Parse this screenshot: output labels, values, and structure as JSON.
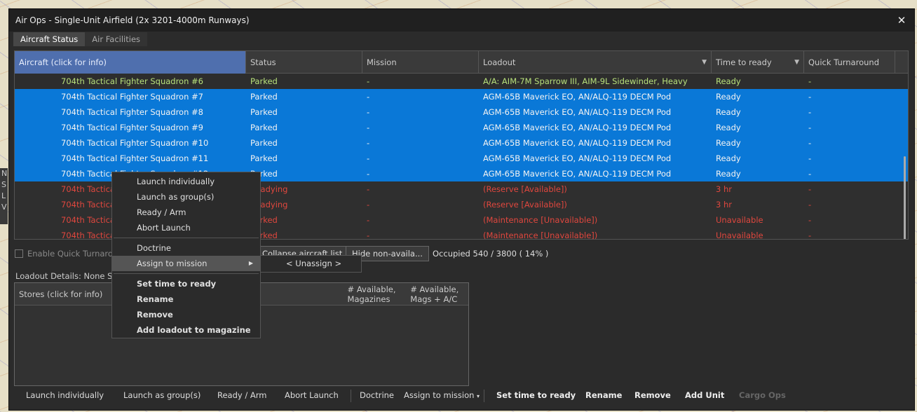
{
  "window": {
    "title": "Air Ops - Single-Unit Airfield (2x 3201-4000m Runways)",
    "close": "✕"
  },
  "tabs": [
    {
      "label": "Aircraft Status"
    },
    {
      "label": "Air Facilities"
    }
  ],
  "grid": {
    "headers": [
      "Aircraft (click for info)",
      "Status",
      "Mission",
      "Loadout",
      "Time to ready",
      "Quick Turnaround"
    ],
    "rows": [
      {
        "aircraft": "704th Tactical Fighter Squadron #6",
        "status": "Parked",
        "mission": "-",
        "loadout": "A/A: AIM-7M Sparrow III, AIM-9L Sidewinder, Heavy",
        "time": "Ready",
        "quick": "-"
      },
      {
        "aircraft": "704th Tactical Fighter Squadron #7",
        "status": "Parked",
        "mission": "-",
        "loadout": "AGM-65B Maverick EO, AN/ALQ-119 DECM Pod",
        "time": "Ready",
        "quick": "-"
      },
      {
        "aircraft": "704th Tactical Fighter Squadron #8",
        "status": "Parked",
        "mission": "-",
        "loadout": "AGM-65B Maverick EO, AN/ALQ-119 DECM Pod",
        "time": "Ready",
        "quick": "-"
      },
      {
        "aircraft": "704th Tactical Fighter Squadron #9",
        "status": "Parked",
        "mission": "-",
        "loadout": "AGM-65B Maverick EO, AN/ALQ-119 DECM Pod",
        "time": "Ready",
        "quick": "-"
      },
      {
        "aircraft": "704th Tactical Fighter Squadron #10",
        "status": "Parked",
        "mission": "-",
        "loadout": "AGM-65B Maverick EO, AN/ALQ-119 DECM Pod",
        "time": "Ready",
        "quick": "-"
      },
      {
        "aircraft": "704th Tactical Fighter Squadron #11",
        "status": "Parked",
        "mission": "-",
        "loadout": "AGM-65B Maverick EO, AN/ALQ-119 DECM Pod",
        "time": "Ready",
        "quick": "-"
      },
      {
        "aircraft": "704th Tactical Fighter Squadron #12",
        "status": "Parked",
        "mission": "-",
        "loadout": "AGM-65B Maverick EO, AN/ALQ-119 DECM Pod",
        "time": "Ready",
        "quick": "-"
      },
      {
        "aircraft": "704th Tactical Fighter Squadron #13",
        "status": "Readying",
        "mission": "-",
        "loadout": "(Reserve [Available])",
        "time": "3 hr",
        "quick": "-"
      },
      {
        "aircraft": "704th Tactical Fighter Squadron #14",
        "status": "Readying",
        "mission": "-",
        "loadout": "(Reserve [Available])",
        "time": "3 hr",
        "quick": "-"
      },
      {
        "aircraft": "704th Tactical Fighter Squadron #15",
        "status": "Parked",
        "mission": "-",
        "loadout": "(Maintenance [Unavailable])",
        "time": "Unavailable",
        "quick": "-"
      },
      {
        "aircraft": "704th Tactical Fighter Squadron #16",
        "status": "Parked",
        "mission": "-",
        "loadout": "(Maintenance [Unavailable])",
        "time": "Unavailable",
        "quick": "-"
      }
    ]
  },
  "mid": {
    "enable_quick": "Enable Quick Turnaround",
    "collapse": "Collapse aircraft list",
    "hide": "Hide non-availa...",
    "occupied": "Occupied 540 / 3800 ( 14% )"
  },
  "loadout_details": "Loadout Details: None Selected",
  "stores": {
    "col1": "Stores (click for info)",
    "col2a": "# Available,",
    "col2b": "Magazines",
    "col3a": "# Available,",
    "col3b": "Mags + A/C"
  },
  "context_menu": {
    "launch_individually": "Launch individually",
    "launch_group": "Launch as group(s)",
    "ready_arm": "Ready / Arm",
    "abort": "Abort Launch",
    "doctrine": "Doctrine",
    "assign": "Assign to mission",
    "set_time": "Set time to ready",
    "rename": "Rename",
    "remove": "Remove",
    "add_loadout": "Add loadout to magazine",
    "submenu_unassign": "< Unassign >"
  },
  "bottom": {
    "launch_individually": "Launch individually",
    "launch_group": "Launch as group(s)",
    "ready_arm": "Ready / Arm",
    "abort": "Abort Launch",
    "doctrine": "Doctrine",
    "assign": "Assign to mission",
    "set_time": "Set time to ready",
    "rename": "Rename",
    "remove": "Remove",
    "add_unit": "Add Unit",
    "cargo_ops": "Cargo Ops"
  },
  "side": {
    "letters": [
      "N",
      "S",
      "L",
      "V"
    ]
  },
  "colors": {
    "selected": "#0a78d7",
    "red_text": "#e0473e",
    "green_text": "#b7e07a",
    "header_active": "#4f6fae"
  }
}
